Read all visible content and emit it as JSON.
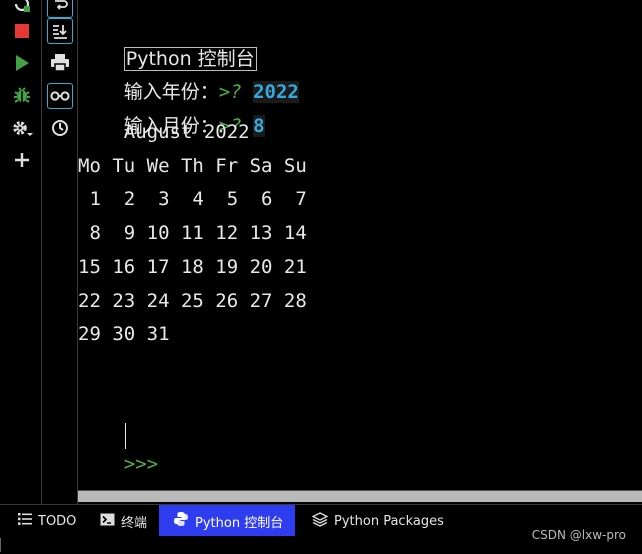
{
  "toolbar_left": {
    "icons": [
      "rerun-icon",
      "stop-icon",
      "run-icon",
      "debug-icon",
      "settings-icon",
      "add-icon"
    ],
    "colors": {
      "stop": "#e53935",
      "run": "#43a047",
      "debug": "#43a047"
    }
  },
  "toolbar_right": {
    "icons": [
      "soft-wrap-icon",
      "scroll-to-end-icon",
      "print-icon",
      "show-variables-icon",
      "history-icon"
    ]
  },
  "console": {
    "title": "Python 控制台",
    "year_prompt_label": "输入年份：",
    "month_prompt_label": "输入月份：",
    "prompt_marker": ">? ",
    "year_value": "2022",
    "month_value": "8",
    "calendar_header": "    August 2022",
    "weekdays": "Mo Tu We Th Fr Sa Su",
    "weeks": [
      " 1  2  3  4  5  6  7",
      " 8  9 10 11 12 13 14",
      "15 16 17 18 19 20 21",
      "22 23 24 25 26 27 28",
      "29 30 31"
    ],
    "repl_prompt": ">>> ",
    "colors": {
      "prompt": "#4caf50",
      "input": "#35a9e0"
    }
  },
  "bottom_tabs": [
    {
      "label": "TODO",
      "icon": "list-icon",
      "active": false
    },
    {
      "label": "终端",
      "icon": "terminal-icon",
      "active": false
    },
    {
      "label": "Python 控制台",
      "icon": "python-icon",
      "active": true
    },
    {
      "label": "Python Packages",
      "icon": "layers-icon",
      "active": false
    }
  ],
  "active_tab_color": "#2f3df0",
  "watermark": "CSDN @lxw-pro"
}
